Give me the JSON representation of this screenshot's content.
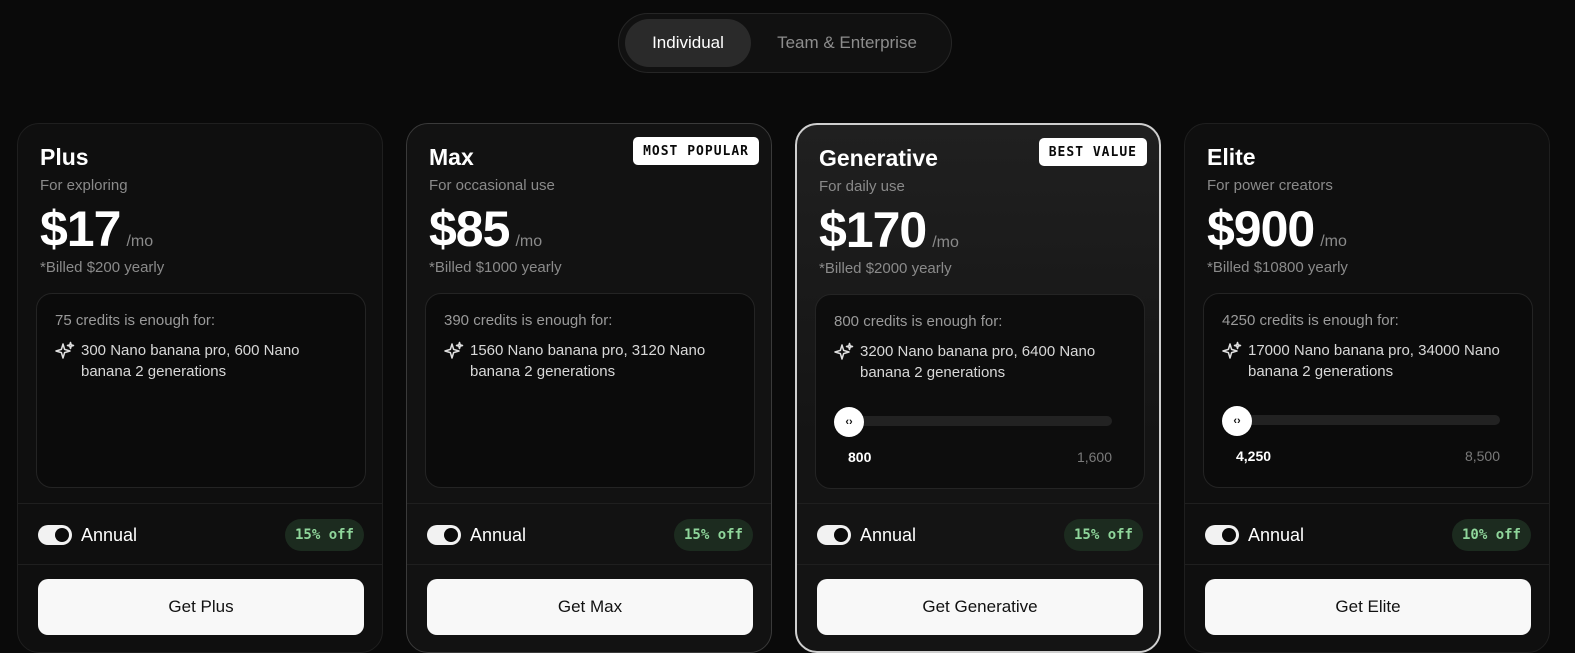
{
  "tabs": [
    {
      "label": "Individual",
      "active": true
    },
    {
      "label": "Team & Enterprise",
      "active": false
    }
  ],
  "plans": [
    {
      "name": "Plus",
      "subtitle": "For exploring",
      "price": "$17",
      "period": "/mo",
      "billed": "*Billed $200 yearly",
      "credits_text": "75 credits is enough for:",
      "generations": "300 Nano banana pro, 600 Nano banana 2 generations",
      "annual_label": "Annual",
      "discount": "15% off",
      "cta": "Get Plus"
    },
    {
      "name": "Max",
      "subtitle": "For occasional use",
      "price": "$85",
      "period": "/mo",
      "billed": "*Billed $1000 yearly",
      "badge": "MOST POPULAR",
      "credits_text": "390 credits is enough for:",
      "generations": "1560 Nano banana pro, 3120 Nano banana 2 generations",
      "annual_label": "Annual",
      "discount": "15% off",
      "cta": "Get Max"
    },
    {
      "name": "Generative",
      "subtitle": "For daily use",
      "price": "$170",
      "period": "/mo",
      "billed": "*Billed $2000 yearly",
      "badge": "BEST VALUE",
      "credits_text": "800 credits is enough for:",
      "generations": "3200 Nano banana pro, 6400 Nano banana 2 generations",
      "slider": {
        "min_label": "800",
        "max_label": "1,600",
        "thumb_glyph": "‹›",
        "position": 0
      },
      "annual_label": "Annual",
      "discount": "15% off",
      "cta": "Get Generative"
    },
    {
      "name": "Elite",
      "subtitle": "For power creators",
      "price": "$900",
      "period": "/mo",
      "billed": "*Billed $10800 yearly",
      "credits_text": "4250 credits is enough for:",
      "generations": "17000 Nano banana pro, 34000 Nano banana 2 generations",
      "slider": {
        "min_label": "4,250",
        "max_label": "8,500",
        "thumb_glyph": "‹›",
        "position": 0
      },
      "annual_label": "Annual",
      "discount": "10% off",
      "cta": "Get Elite"
    }
  ],
  "icons": {
    "generation": "sparkle-icon",
    "slider_thumb": "chevron-left-right-icon"
  },
  "colors": {
    "background": "#0a0a0a",
    "discount_text": "#8fd69b",
    "discount_bg": "#1c2b1f",
    "cta_bg": "#f8f8f8"
  }
}
